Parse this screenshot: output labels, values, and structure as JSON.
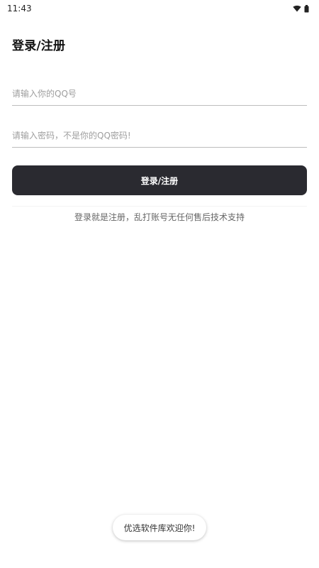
{
  "status_bar": {
    "time": "11:43",
    "icons": [
      "wifi-icon",
      "battery-icon"
    ]
  },
  "page": {
    "title": "登录/注册"
  },
  "form": {
    "qq_placeholder": "请输入你的QQ号",
    "qq_value": "",
    "password_placeholder": "请输入密码，不是你的QQ密码!",
    "password_value": "",
    "submit_label": "登录/注册"
  },
  "notice": {
    "text": "登录就是注册，乱打账号无任何售后技术支持"
  },
  "toast": {
    "text": "优选软件库欢迎你!"
  },
  "colors": {
    "button_bg": "#2a2a30",
    "button_text": "#ffffff",
    "placeholder": "#9e9e9e",
    "divider": "#bdbdbd"
  }
}
